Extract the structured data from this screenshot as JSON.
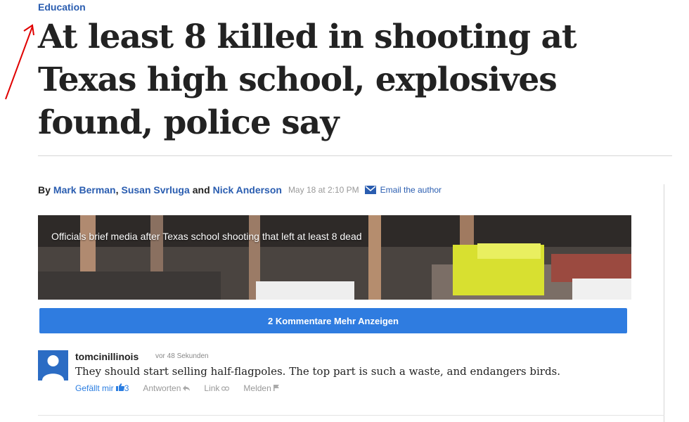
{
  "article": {
    "section": "Education",
    "headline": "At least 8 killed in shooting at Texas high school, explosives found, police say",
    "byline": {
      "by": "By",
      "authors": [
        "Mark Berman",
        "Susan Svrluga",
        "Nick Anderson"
      ],
      "and": "and",
      "date": "May 18 at 2:10 PM",
      "email_label": "Email the author"
    }
  },
  "video": {
    "caption": "Officials brief media after Texas school shooting that left at least 8 dead"
  },
  "comments": {
    "more_button": "2 Kommentare Mehr Anzeigen",
    "items": [
      {
        "user": "tomcinillinois",
        "time": "vor 48 Sekunden",
        "text": "They should start selling half-flagpoles. The top part is such a waste, and endangers birds.",
        "like_label": "Gefällt mir",
        "like_count": "3",
        "reply_label": "Antworten",
        "link_label": "Link",
        "report_label": "Melden"
      }
    ]
  },
  "colors": {
    "link_blue": "#2a5db0",
    "button_blue": "#2f7ce0",
    "annotation_red": "#e00000"
  },
  "icons": [
    "red-arrow-annotation",
    "mail-icon",
    "avatar-icon",
    "thumbs-up-icon",
    "reply-icon",
    "link-icon",
    "flag-icon"
  ]
}
